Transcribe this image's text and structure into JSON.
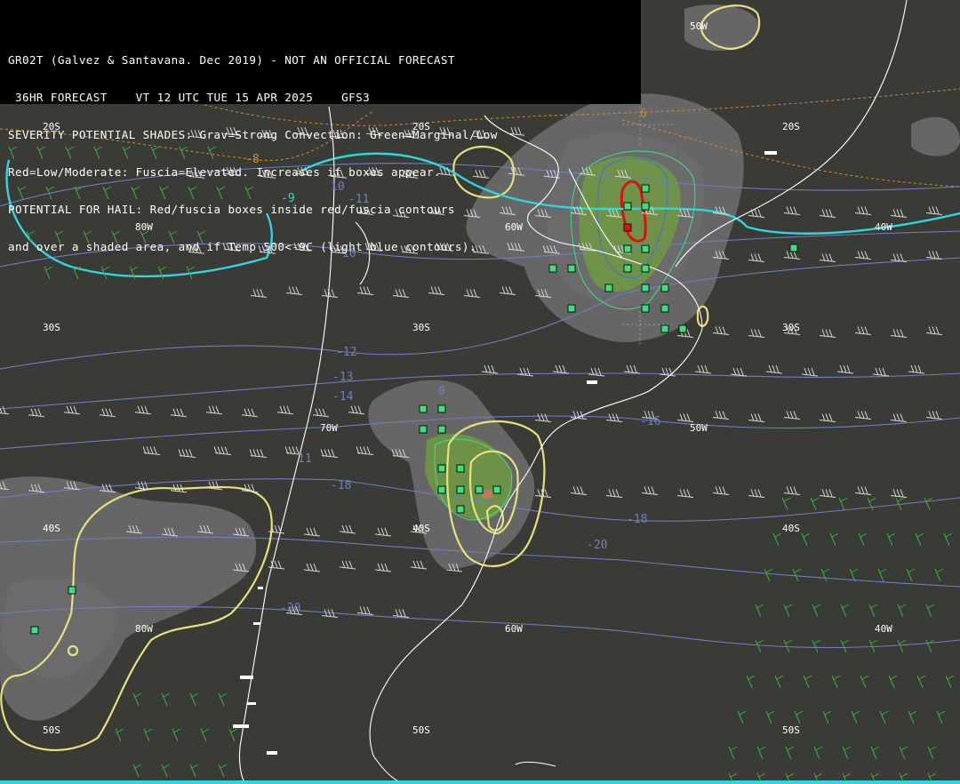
{
  "header": {
    "lines": [
      "GR02T (Galvez & Santavana. Dec 2019) - NOT AN OFFICIAL FORECAST",
      " 36HR FORECAST    VT 12 UTC TUE 15 APR 2025    GFS3",
      "SEVERITY POTENTIAL SHADES: Grav=Strong Convection: Green=Marginal/Low",
      "Red=Low/Moderate: Fuscia=Elevated. Increases if boxes appear.",
      "POTENTIAL FOR HAIL: Red/fuscia boxes inside red/fuscia contours",
      "and over a shaded area, and if Temp 500<-9C (light blue contours)."
    ]
  },
  "grid_labels": {
    "lat_20": "20S",
    "lat_30": "30S",
    "lat_40": "40S",
    "lat_50": "50S",
    "lon_80": "80W",
    "lon_70": "70W",
    "lon_60": "60W",
    "lon_50": "50W",
    "lon_40": "40W"
  },
  "temp_contour_labels": {
    "t_neg10": "-10",
    "t_neg11": "-11",
    "t_neg12": "-12",
    "t_neg13": "-13",
    "t_neg14": "-14",
    "t_neg16": "-16",
    "t_neg18": "-18",
    "t_neg20": "-20",
    "t_10": "10",
    "t_11": "11",
    "t_8": "8",
    "t_0": "0"
  },
  "orange_contour_labels": {
    "o_neg8": "-8",
    "o_neg6": "6",
    "o_neg8b": "8"
  },
  "cyan_contour_labels": {
    "c_neg9": "-9"
  },
  "colors": {
    "background": "#3a3a36",
    "header_bg": "#000000",
    "coast": "#ffffff",
    "temp_contour": "#6d7fc0",
    "yellow_contour": "#e8e07a",
    "cyan_contour": "#2fd6e0",
    "orange_contour": "#d08a2c",
    "shade_gray": "#8a8a90",
    "shade_green": "#6fa03c",
    "hail_box": "#3ee07a",
    "hail_red": "#e01010"
  }
}
